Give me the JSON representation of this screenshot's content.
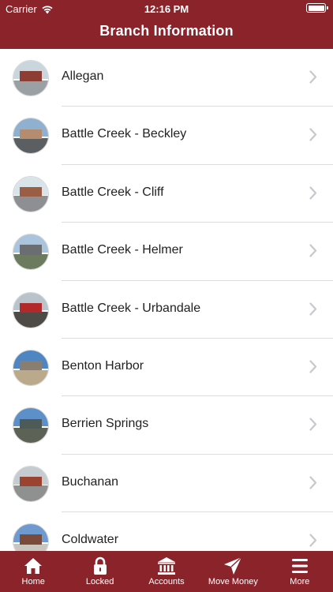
{
  "status_bar": {
    "carrier": "Carrier",
    "time": "12:16 PM"
  },
  "header": {
    "title": "Branch Information"
  },
  "branches": [
    {
      "name": "Allegan",
      "sky": "#c9d6de",
      "building": "#8c3d34",
      "ground": "#9aa0a3"
    },
    {
      "name": "Battle Creek - Beckley",
      "sky": "#8fb0cf",
      "building": "#b58c70",
      "ground": "#5c5f62"
    },
    {
      "name": "Battle Creek - Cliff",
      "sky": "#d9e3ea",
      "building": "#9b5e44",
      "ground": "#8d8f92"
    },
    {
      "name": "Battle Creek - Helmer",
      "sky": "#a9c4dc",
      "building": "#6b6e70",
      "ground": "#6c7a5e"
    },
    {
      "name": "Battle Creek - Urbandale",
      "sky": "#b8c3cb",
      "building": "#b3282a",
      "ground": "#4e4a45"
    },
    {
      "name": "Benton Harbor",
      "sky": "#4f86c2",
      "building": "#8a7e72",
      "ground": "#bba98b"
    },
    {
      "name": "Berrien Springs",
      "sky": "#5d8fc9",
      "building": "#4d5a56",
      "ground": "#5d6257"
    },
    {
      "name": "Buchanan",
      "sky": "#c4ccd1",
      "building": "#9a4331",
      "ground": "#8f9190"
    },
    {
      "name": "Coldwater",
      "sky": "#6f9ad0",
      "building": "#7a4a3a",
      "ground": "#c9c6c0"
    }
  ],
  "tabs": [
    {
      "label": "Home",
      "icon": "home-icon"
    },
    {
      "label": "Locked",
      "icon": "lock-icon"
    },
    {
      "label": "Accounts",
      "icon": "bank-icon"
    },
    {
      "label": "Move Money",
      "icon": "paper-plane-icon"
    },
    {
      "label": "More",
      "icon": "menu-icon"
    }
  ],
  "colors": {
    "brand": "#8a232a",
    "chevron": "#c7c7cc",
    "separator": "#dcdcdc"
  }
}
